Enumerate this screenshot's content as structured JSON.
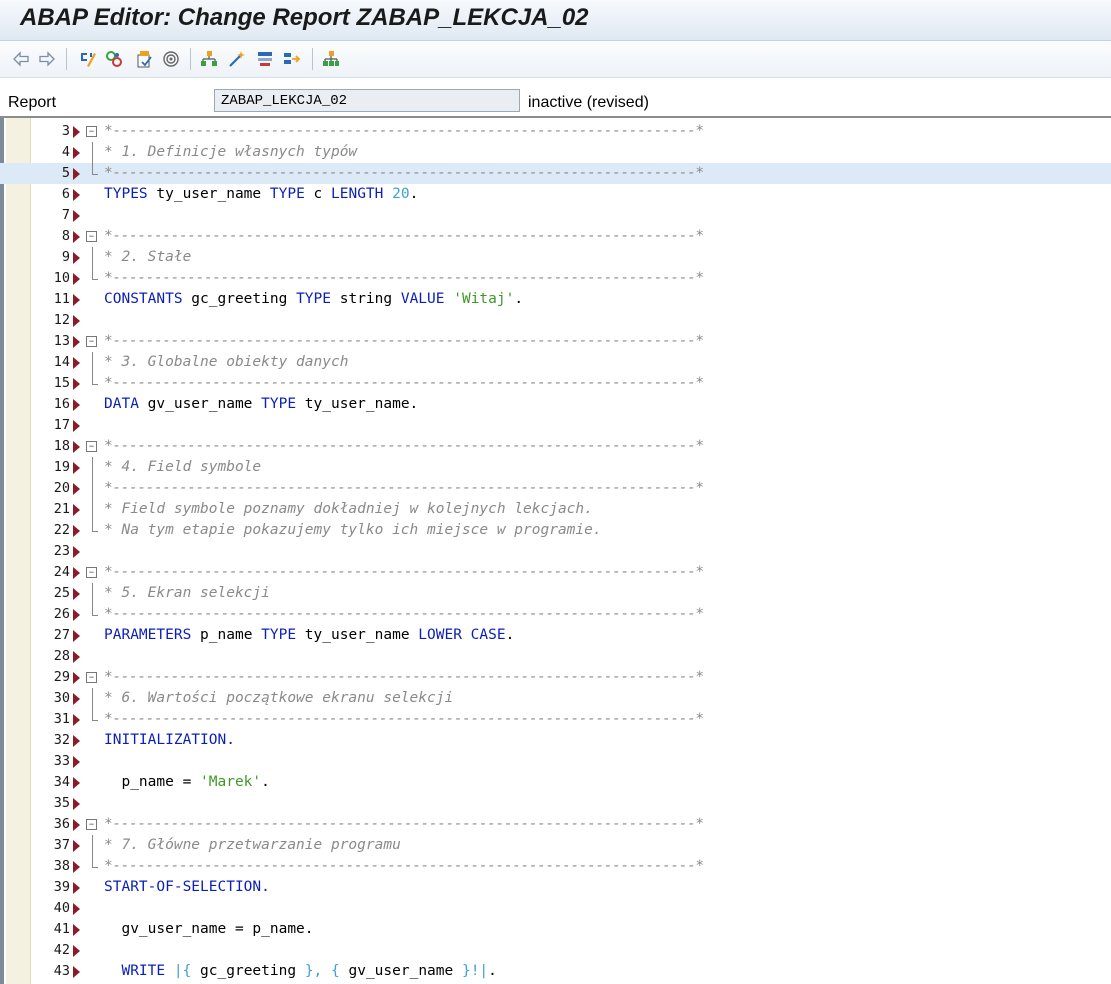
{
  "window": {
    "title": "ABAP Editor: Change Report ZABAP_LEKCJA_02"
  },
  "toolbar": {
    "icons": [
      "back-arrow-icon",
      "forward-arrow-icon",
      "toggle-display-change-icon",
      "other-object-icon",
      "activate-icon",
      "check-icon",
      "where-used-icon",
      "object-list-icon",
      "pattern-icon",
      "pretty-printer-icon",
      "display-object-list-icon",
      "navigation-window-icon"
    ],
    "colors": {
      "accent": "#f0a020",
      "blue": "#2b68b8",
      "green": "#3aa040"
    }
  },
  "report": {
    "label": "Report",
    "name": "ZABAP_LEKCJA_02",
    "status": "inactive (revised)"
  },
  "editor": {
    "colors": {
      "keyword": "#0b1fb8",
      "string": "#3d9a27",
      "number": "#3fa0d2",
      "comment": "#8a8a8a",
      "highlight": "#dce9f6",
      "marker": "#8a1c2a"
    },
    "lines": [
      {
        "n": "3",
        "fold": "start",
        "segs": [
          {
            "t": "*----------------------------------------------------------------------*",
            "c": "dash"
          }
        ]
      },
      {
        "n": "4",
        "fold": "mid",
        "segs": [
          {
            "t": "* 1. Definicje własnych typów",
            "c": "com"
          }
        ]
      },
      {
        "n": "5",
        "fold": "end",
        "hl": true,
        "segs": [
          {
            "t": "*----------------------------------------------------------------------*",
            "c": "dash"
          }
        ]
      },
      {
        "n": "6",
        "segs": [
          {
            "t": "TYPES",
            "c": "kw"
          },
          {
            "t": " ty_user_name "
          },
          {
            "t": "TYPE",
            "c": "kw"
          },
          {
            "t": " c "
          },
          {
            "t": "LENGTH",
            "c": "kw"
          },
          {
            "t": " "
          },
          {
            "t": "20",
            "c": "num"
          },
          {
            "t": "."
          }
        ]
      },
      {
        "n": "7",
        "segs": []
      },
      {
        "n": "8",
        "fold": "start",
        "segs": [
          {
            "t": "*----------------------------------------------------------------------*",
            "c": "dash"
          }
        ]
      },
      {
        "n": "9",
        "fold": "mid",
        "segs": [
          {
            "t": "* 2. Stałe",
            "c": "com"
          }
        ]
      },
      {
        "n": "10",
        "fold": "end",
        "segs": [
          {
            "t": "*----------------------------------------------------------------------*",
            "c": "dash"
          }
        ]
      },
      {
        "n": "11",
        "segs": [
          {
            "t": "CONSTANTS",
            "c": "kw"
          },
          {
            "t": " gc_greeting "
          },
          {
            "t": "TYPE",
            "c": "kw"
          },
          {
            "t": " string "
          },
          {
            "t": "VALUE",
            "c": "kw"
          },
          {
            "t": " "
          },
          {
            "t": "'Witaj'",
            "c": "str"
          },
          {
            "t": "."
          }
        ]
      },
      {
        "n": "12",
        "segs": []
      },
      {
        "n": "13",
        "fold": "start",
        "segs": [
          {
            "t": "*----------------------------------------------------------------------*",
            "c": "dash"
          }
        ]
      },
      {
        "n": "14",
        "fold": "mid",
        "segs": [
          {
            "t": "* 3. Globalne obiekty danych",
            "c": "com"
          }
        ]
      },
      {
        "n": "15",
        "fold": "end",
        "segs": [
          {
            "t": "*----------------------------------------------------------------------*",
            "c": "dash"
          }
        ]
      },
      {
        "n": "16",
        "segs": [
          {
            "t": "DATA",
            "c": "kw"
          },
          {
            "t": " gv_user_name "
          },
          {
            "t": "TYPE",
            "c": "kw"
          },
          {
            "t": " ty_user_name."
          }
        ]
      },
      {
        "n": "17",
        "segs": []
      },
      {
        "n": "18",
        "fold": "start",
        "segs": [
          {
            "t": "*----------------------------------------------------------------------*",
            "c": "dash"
          }
        ]
      },
      {
        "n": "19",
        "fold": "mid",
        "segs": [
          {
            "t": "* 4. Field symbole",
            "c": "com"
          }
        ]
      },
      {
        "n": "20",
        "fold": "mid",
        "segs": [
          {
            "t": "*----------------------------------------------------------------------*",
            "c": "dash"
          }
        ]
      },
      {
        "n": "21",
        "fold": "mid",
        "segs": [
          {
            "t": "* Field symbole poznamy dokładniej w kolejnych lekcjach.",
            "c": "com"
          }
        ]
      },
      {
        "n": "22",
        "fold": "end",
        "segs": [
          {
            "t": "* Na tym etapie pokazujemy tylko ich miejsce w programie.",
            "c": "com"
          }
        ]
      },
      {
        "n": "23",
        "segs": []
      },
      {
        "n": "24",
        "fold": "start",
        "segs": [
          {
            "t": "*----------------------------------------------------------------------*",
            "c": "dash"
          }
        ]
      },
      {
        "n": "25",
        "fold": "mid",
        "segs": [
          {
            "t": "* 5. Ekran selekcji",
            "c": "com"
          }
        ]
      },
      {
        "n": "26",
        "fold": "end",
        "segs": [
          {
            "t": "*----------------------------------------------------------------------*",
            "c": "dash"
          }
        ]
      },
      {
        "n": "27",
        "segs": [
          {
            "t": "PARAMETERS",
            "c": "kw"
          },
          {
            "t": " p_name "
          },
          {
            "t": "TYPE",
            "c": "kw"
          },
          {
            "t": " ty_user_name "
          },
          {
            "t": "LOWER CASE",
            "c": "kw"
          },
          {
            "t": "."
          }
        ]
      },
      {
        "n": "28",
        "segs": []
      },
      {
        "n": "29",
        "fold": "start",
        "segs": [
          {
            "t": "*----------------------------------------------------------------------*",
            "c": "dash"
          }
        ]
      },
      {
        "n": "30",
        "fold": "mid",
        "segs": [
          {
            "t": "* 6. Wartości początkowe ekranu selekcji",
            "c": "com"
          }
        ]
      },
      {
        "n": "31",
        "fold": "end",
        "segs": [
          {
            "t": "*----------------------------------------------------------------------*",
            "c": "dash"
          }
        ]
      },
      {
        "n": "32",
        "segs": [
          {
            "t": "INITIALIZATION.",
            "c": "kw"
          }
        ]
      },
      {
        "n": "33",
        "segs": []
      },
      {
        "n": "34",
        "segs": [
          {
            "t": "  p_name = "
          },
          {
            "t": "'Marek'",
            "c": "str"
          },
          {
            "t": "."
          }
        ]
      },
      {
        "n": "35",
        "segs": []
      },
      {
        "n": "36",
        "fold": "start",
        "segs": [
          {
            "t": "*----------------------------------------------------------------------*",
            "c": "dash"
          }
        ]
      },
      {
        "n": "37",
        "fold": "mid",
        "segs": [
          {
            "t": "* 7. Główne przetwarzanie programu",
            "c": "com"
          }
        ]
      },
      {
        "n": "38",
        "fold": "end",
        "segs": [
          {
            "t": "*----------------------------------------------------------------------*",
            "c": "dash"
          }
        ]
      },
      {
        "n": "39",
        "segs": [
          {
            "t": "START-OF-SELECTION.",
            "c": "kw"
          }
        ]
      },
      {
        "n": "40",
        "segs": []
      },
      {
        "n": "41",
        "segs": [
          {
            "t": "  gv_user_name = p_name."
          }
        ]
      },
      {
        "n": "42",
        "segs": []
      },
      {
        "n": "43",
        "segs": [
          {
            "t": "  "
          },
          {
            "t": "WRITE",
            "c": "kw"
          },
          {
            "t": " "
          },
          {
            "t": "|{",
            "c": "num"
          },
          {
            "t": " gc_greeting "
          },
          {
            "t": "}, {",
            "c": "num"
          },
          {
            "t": " gv_user_name "
          },
          {
            "t": "}!|",
            "c": "num"
          },
          {
            "t": "."
          }
        ]
      }
    ]
  }
}
